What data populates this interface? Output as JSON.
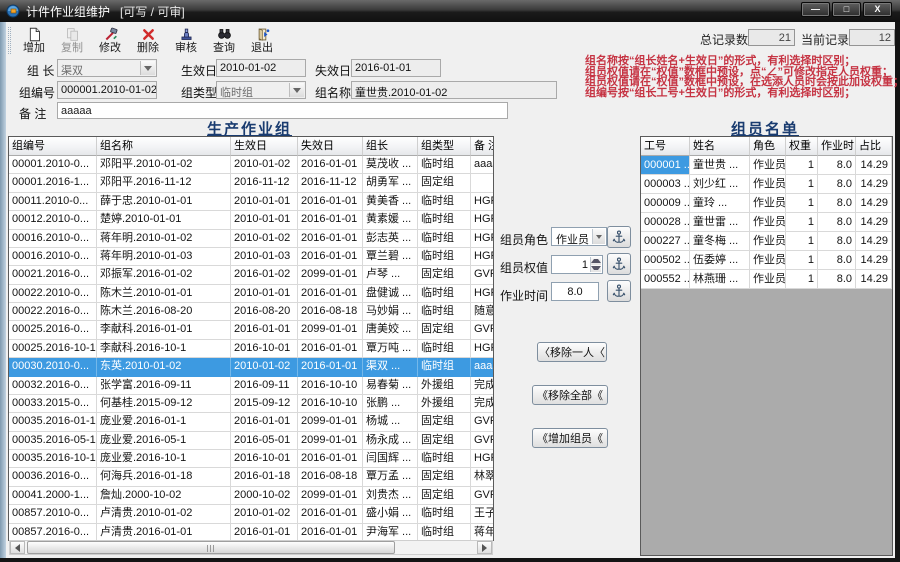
{
  "window": {
    "title": "计件作业组维护",
    "mode": "[可写 / 可审]"
  },
  "window_controls": {
    "minimize": "—",
    "maximize": "□",
    "close": "X"
  },
  "toolbar": {
    "buttons": [
      {
        "label": "增加",
        "icon": "add-icon"
      },
      {
        "label": "复制",
        "icon": "copy-icon",
        "disabled": true
      },
      {
        "label": "修改",
        "icon": "modify-icon"
      },
      {
        "label": "删除",
        "icon": "delete-icon"
      },
      {
        "label": "审核",
        "icon": "audit-icon"
      },
      {
        "label": "查询",
        "icon": "search-icon"
      },
      {
        "label": "退出",
        "icon": "exit-icon"
      }
    ]
  },
  "record_bar": {
    "total_label": "总记录数",
    "total_value": "21",
    "current_label": "当前记录",
    "current_value": "12"
  },
  "notes": [
    "组名称按“组长姓名+生效日”的形式，有利选择时区别；",
    "组员权值请在“权值”数框中预设，点“∠”可修改指定人员权重；",
    "组员权值请在“权值”数框中预设，在选添人员时会按此加设权重；",
    "组编号按“组长工号+生效日”的形式，有利选择时区别；"
  ],
  "form": {
    "leader_label": "组  长",
    "leader_value": "渠双",
    "start_label": "生效日",
    "start_value": "2010-01-02",
    "end_label": "失效日",
    "end_value": "2016-01-01",
    "group_no_label": "组编号",
    "group_no_value": "000001.2010-01-02",
    "group_type_label": "组类型",
    "group_type_value": "临时组",
    "group_name_label": "组名称",
    "group_name_value": "童世贵.2010-01-02",
    "remark_label": "备  注",
    "remark_value": "aaaaa"
  },
  "left_table": {
    "title": "生产作业组",
    "columns": [
      "组编号",
      "组名称",
      "生效日",
      "失效日",
      "组长",
      "组类型",
      "备    注"
    ],
    "selected_row": 11,
    "rows": [
      [
        "00001.2010-0...",
        "邓阳平.2010-01-02",
        "2010-01-02",
        "2016-01-01",
        "莫茂收 ...",
        "临时组",
        "aaaaa"
      ],
      [
        "00001.2016-1...",
        "邓阳平.2016-11-12",
        "2016-11-12",
        "2016-11-12",
        "胡勇军 ...",
        "固定组",
        ""
      ],
      [
        "00011.2010-0...",
        "薛于忠.2010-01-01",
        "2010-01-01",
        "2016-01-01",
        "黄美香 ...",
        "临时组",
        "HGFHFG"
      ],
      [
        "00012.2010-0...",
        "楚婷.2010-01-01",
        "2010-01-01",
        "2016-01-01",
        "黄素媛 ...",
        "临时组",
        "HGFHFG"
      ],
      [
        "00016.2010-0...",
        "蒋年明.2010-01-02",
        "2010-01-02",
        "2016-01-01",
        "彭志英 ...",
        "临时组",
        "HGFHFG"
      ],
      [
        "00016.2010-0...",
        "蒋年明.2010-01-03",
        "2010-01-03",
        "2016-01-01",
        "覃兰碧 ...",
        "临时组",
        "HGFHFG"
      ],
      [
        "00021.2016-0...",
        "邓振军.2016-01-02",
        "2016-01-02",
        "2099-01-01",
        "卢琴    ...",
        "固定组",
        "GVFDGF"
      ],
      [
        "00022.2010-0...",
        "陈木兰.2010-01-01",
        "2010-01-01",
        "2016-01-01",
        "盘健诚 ...",
        "临时组",
        "HGFHFG"
      ],
      [
        "00022.2016-0...",
        "陈木兰.2016-08-20",
        "2016-08-20",
        "2016-08-18",
        "马妙娟 ...",
        "临时组",
        "随意"
      ],
      [
        "00025.2016-0...",
        "李献科.2016-01-01",
        "2016-01-01",
        "2099-01-01",
        "唐美姣 ...",
        "固定组",
        "GVFDGF"
      ],
      [
        "00025.2016-10-1",
        "李献科.2016-10-1",
        "2016-10-01",
        "2016-01-01",
        "覃万吨 ...",
        "临时组",
        "HGFHFG"
      ],
      [
        "00030.2010-0...",
        "东英.2010-01-02",
        "2010-01-02",
        "2016-01-01",
        "渠双    ...",
        "临时组",
        "aaaaa"
      ],
      [
        "00032.2016-0...",
        "张学富.2016-09-11",
        "2016-09-11",
        "2016-10-10",
        "易春菊 ...",
        "外援组",
        "完成工"
      ],
      [
        "00033.2015-0...",
        "何基桂.2015-09-12",
        "2015-09-12",
        "2016-10-10",
        "张鹏    ...",
        "外援组",
        "完成工"
      ],
      [
        "00035.2016-01-1",
        "庞业爱.2016-01-1",
        "2016-01-01",
        "2099-01-01",
        "杨城    ...",
        "固定组",
        "GVFDGF"
      ],
      [
        "00035.2016-05-1",
        "庞业爱.2016-05-1",
        "2016-05-01",
        "2099-01-01",
        "杨永成 ...",
        "固定组",
        "GVFDGF"
      ],
      [
        "00035.2016-10-1",
        "庞业爱.2016-10-1",
        "2016-10-01",
        "2016-01-01",
        "闫国辉 ...",
        "临时组",
        "HGFHFG"
      ],
      [
        "00036.2016-0...",
        "何海兵.2016-01-18",
        "2016-01-18",
        "2016-08-18",
        "覃万孟 ...",
        "固定组",
        "林翠叶"
      ],
      [
        "00041.2000-1...",
        "詹灿.2000-10-02",
        "2000-10-02",
        "2099-01-01",
        "刘贵杰 ...",
        "固定组",
        "GVFDGF"
      ],
      [
        "00857.2010-0...",
        "卢清贵.2010-01-02",
        "2010-01-02",
        "2016-01-01",
        "盛小娟 ...",
        "临时组",
        "王子山"
      ],
      [
        "00857.2016-0...",
        "卢清贵.2016-01-01",
        "2016-01-01",
        "2016-01-01",
        "尹海军 ...",
        "临时组",
        "蒋年明"
      ]
    ]
  },
  "right_table": {
    "title": "组员名单",
    "columns": [
      "工号",
      "姓名",
      "角色",
      "权重",
      "作业时",
      "占比"
    ],
    "selected_cell": [
      0,
      0
    ],
    "rows": [
      [
        "000001 ...",
        "童世贵 ...",
        "作业员",
        "1",
        "8.0",
        "14.29"
      ],
      [
        "000003 ...",
        "刘少红 ...",
        "作业员",
        "1",
        "8.0",
        "14.29"
      ],
      [
        "000009 ...",
        "童玲    ...",
        "作业员",
        "1",
        "8.0",
        "14.29"
      ],
      [
        "000028 ...",
        "童世雷 ...",
        "作业员",
        "1",
        "8.0",
        "14.29"
      ],
      [
        "000227 ...",
        "童冬梅 ...",
        "作业员",
        "1",
        "8.0",
        "14.29"
      ],
      [
        "000502 ...",
        "伍委婷 ...",
        "作业员",
        "1",
        "8.0",
        "14.29"
      ],
      [
        "000552 ...",
        "林燕珊 ...",
        "作业员",
        "1",
        "8.0",
        "14.29"
      ]
    ]
  },
  "middle": {
    "role_label": "组员角色",
    "role_value": "作业员",
    "weight_label": "组员权值",
    "weight_value": "1",
    "time_label": "作业时间",
    "time_value": "8.0",
    "remove_one_label": "〈移除一人〈",
    "remove_all_label": "《移除全部《",
    "add_members_label": "《增加组员《"
  },
  "colors": {
    "selection": "#3d9ae1",
    "note_red": "#c63443",
    "section_title": "#1a3c70"
  }
}
